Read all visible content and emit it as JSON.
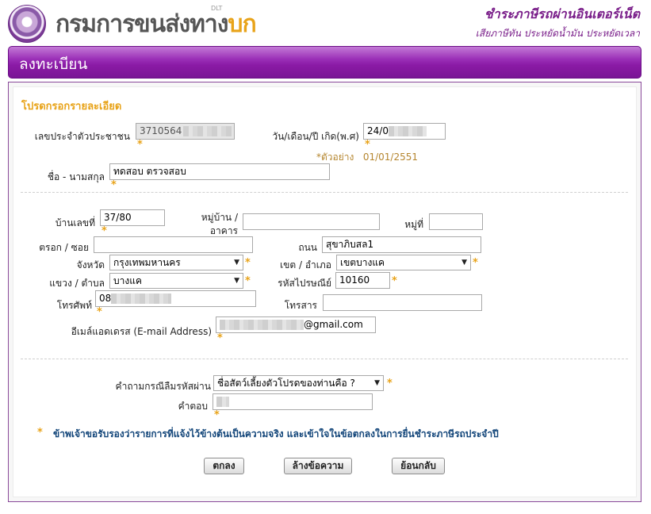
{
  "header": {
    "logo_text_main": "กรมการขนส่งทาง",
    "logo_text_accent": "บก",
    "logo_small": "DLT",
    "tagline": "ชำระภาษีรถผ่านอินเตอร์เน็ต",
    "subtagline": "เสียภาษีทัน ประหยัดน้ำมัน ประหยัดเวลา"
  },
  "page_title": "ลงทะเบียน",
  "form": {
    "section_title": "โปรดกรอกรายละเอียด",
    "citizen_id": {
      "label": "เลขประจำตัวประชาชน",
      "value": "3710564"
    },
    "birth_date": {
      "label": "วัน/เดือน/ปี เกิด(พ.ศ)",
      "value": "24/0"
    },
    "date_hint": {
      "prefix": "*ตัวอย่าง",
      "example": "01/01/2551"
    },
    "full_name": {
      "label": "ชื่อ - นามสกุล",
      "value": "ทดสอบ ตรวจสอบ"
    },
    "house_no": {
      "label": "บ้านเลขที่",
      "value": "37/80"
    },
    "village": {
      "label_line1": "หมู่บ้าน /",
      "label_line2": "อาคาร",
      "value": ""
    },
    "moo": {
      "label": "หมู่ที่",
      "value": ""
    },
    "soi": {
      "label": "ตรอก / ซอย",
      "value": ""
    },
    "road": {
      "label": "ถนน",
      "value": "สุขาภิบสล1"
    },
    "province": {
      "label": "จังหวัด",
      "value": "กรุงเทพมหานคร"
    },
    "district": {
      "label": "เขต / อำเภอ",
      "value": "เขตบางแค"
    },
    "subdistrict": {
      "label": "แขวง / ตำบล",
      "value": "บางแค"
    },
    "postcode": {
      "label": "รหัสไปรษณีย์",
      "value": "10160"
    },
    "phone": {
      "label": "โทรศัพท์",
      "value": "08"
    },
    "fax": {
      "label": "โทรสาร",
      "value": ""
    },
    "email": {
      "label": "อีเมล์แอดเดรส (E-mail Address)",
      "value": "@gmail.com"
    },
    "security_question": {
      "label": "คำถามกรณีลืมรหัสผ่าน",
      "value": "ชื่อสัตว์เลี้ยงตัวโปรดของท่านคือ ?"
    },
    "security_answer": {
      "label": "คำตอบ",
      "value": ""
    },
    "required_mark": "*",
    "certification": "ข้าพเจ้าขอรับรองว่ารายการที่แจ้งไว้ข้างต้นเป็นความจริง และเข้าใจในข้อตกลงในการยื่นชำระภาษีรถประจำปี"
  },
  "buttons": {
    "submit": "ตกลง",
    "clear": "ล้างข้อความ",
    "back": "ย้อนกลับ"
  },
  "colors": {
    "brand_purple": "#7a1f8a",
    "required_orange": "#e8a319",
    "hint_brown": "#b5862f",
    "certify_blue": "#13467a"
  }
}
